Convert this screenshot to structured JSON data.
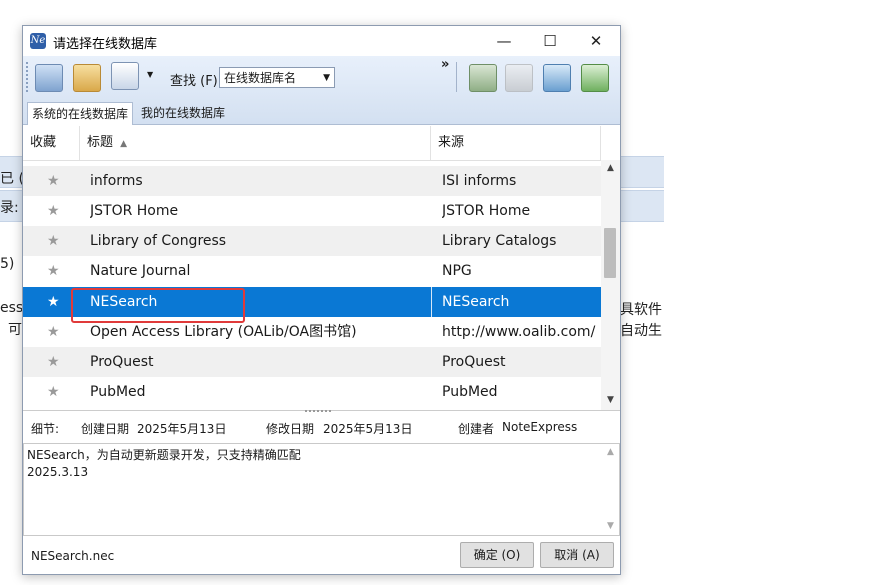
{
  "background": {
    "fragments": [
      {
        "text": "已 (N"
      },
      {
        "text": "录:"
      },
      {
        "text": "5)"
      },
      {
        "text": "ess"
      },
      {
        "text": "可"
      },
      {
        "text": "具软件"
      },
      {
        "text": "自动生"
      }
    ]
  },
  "dialog": {
    "title": "请选择在线数据库",
    "controls": {
      "minimize": "—",
      "maximize": "☐",
      "close": "✕"
    }
  },
  "toolbar": {
    "find_label": "查找 (F)",
    "find_value": "在线数据库名",
    "overflow": "»"
  },
  "tabs": [
    {
      "label": "系统的在线数据库",
      "active": true
    },
    {
      "label": "我的在线数据库",
      "active": false
    }
  ],
  "grid": {
    "columns": [
      "收藏",
      "标题",
      "来源"
    ],
    "sort_glyph": "▲",
    "rows": [
      {
        "title": "informs",
        "source": "ISI informs",
        "selected": false
      },
      {
        "title": "JSTOR Home",
        "source": "JSTOR Home",
        "selected": false
      },
      {
        "title": "Library of Congress",
        "source": "Library Catalogs",
        "selected": false
      },
      {
        "title": "Nature Journal",
        "source": "NPG",
        "selected": false
      },
      {
        "title": "NESearch",
        "source": "NESearch",
        "selected": true
      },
      {
        "title": "Open Access Library (OALib/OA图书馆)",
        "source": "http://www.oalib.com/",
        "selected": false
      },
      {
        "title": "ProQuest",
        "source": "ProQuest",
        "selected": false
      },
      {
        "title": "PubMed",
        "source": "PubMed",
        "selected": false
      }
    ]
  },
  "details": {
    "label": "细节:",
    "created_label": "创建日期",
    "created_value": "2025年5月13日",
    "modified_label": "修改日期",
    "modified_value": "2025年5月13日",
    "creator_label": "创建者",
    "creator_value": "NoteExpress"
  },
  "notes": {
    "line1": "NESearch，为自动更新题录开发，只支持精确匹配",
    "line2": "2025.3.13"
  },
  "status": {
    "file_name": "NESearch.nec",
    "ok_label": "确定 (O)",
    "cancel_label": "取消 (A)"
  },
  "colors": {
    "selection": "#0a78d4",
    "highlight_box": "#e03a3a",
    "toolbar_top": "#e8f0fb",
    "toolbar_bottom": "#d3e0f1"
  }
}
